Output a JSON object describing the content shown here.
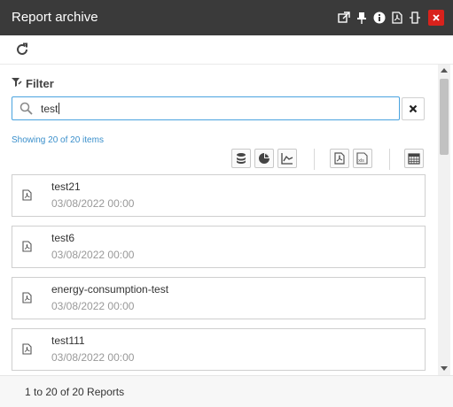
{
  "window": {
    "title": "Report archive"
  },
  "titlebar_icons": [
    "popout-icon",
    "pin-icon",
    "info-icon",
    "pdf-icon",
    "resize-icon",
    "close-icon"
  ],
  "colors": {
    "titlebar": "#3a3a3a",
    "close": "#d9221c",
    "accent": "#4aa3df",
    "link": "#3a8fcb"
  },
  "filter": {
    "label": "Filter",
    "value": "test"
  },
  "status": {
    "showing": "Showing 20 of 20 items"
  },
  "action_icons": [
    "database-icon",
    "pie-chart-icon",
    "line-chart-icon",
    "pdf-export-icon",
    "xls-export-icon",
    "calendar-icon"
  ],
  "reports": [
    {
      "name": "test21",
      "date": "03/08/2022 00:00"
    },
    {
      "name": "test6",
      "date": "03/08/2022 00:00"
    },
    {
      "name": "energy-consumption-test",
      "date": "03/08/2022 00:00"
    },
    {
      "name": "test111",
      "date": "03/08/2022 00:00"
    }
  ],
  "footer": {
    "summary": "1 to 20 of 20 Reports"
  }
}
